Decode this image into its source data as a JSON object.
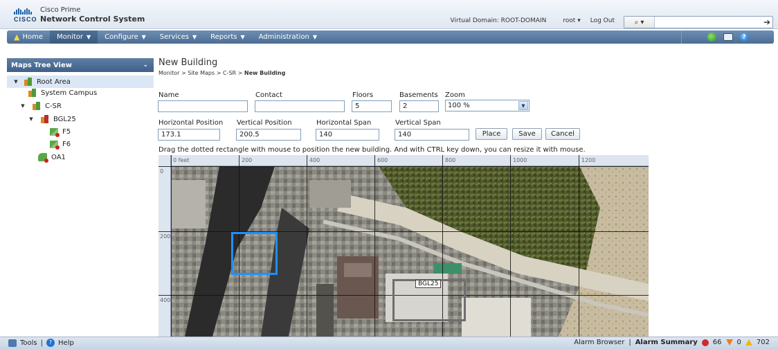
{
  "header": {
    "product_line1": "Cisco Prime",
    "product_line2": "Network Control System",
    "virtual_domain": "Virtual Domain: ROOT-DOMAIN",
    "user": "root ▾",
    "logout": "Log Out",
    "search_type": "⌕ ▾",
    "search_placeholder": "",
    "brand_color": "#1b5fa8"
  },
  "nav": {
    "home": "Home",
    "monitor": "Monitor",
    "configure": "Configure",
    "services": "Services",
    "reports": "Reports",
    "administration": "Administration"
  },
  "sidebar": {
    "title": "Maps Tree View",
    "items": [
      {
        "label": "Root Area",
        "expanded": true,
        "icon": "building-icon"
      },
      {
        "label": "System Campus",
        "icon": "building-icon"
      },
      {
        "label": "C-SR",
        "expanded": true,
        "icon": "building-icon"
      },
      {
        "label": "BGL25",
        "expanded": true,
        "icon": "building-alarm-icon"
      },
      {
        "label": "F5",
        "icon": "floor-icon"
      },
      {
        "label": "F6",
        "icon": "floor-icon"
      },
      {
        "label": "OA1",
        "icon": "outdoor-area-icon"
      }
    ]
  },
  "main": {
    "title": "New Building",
    "breadcrumb": [
      "Monitor",
      "Site Maps",
      "C-SR",
      "New Building"
    ],
    "fields": {
      "name_label": "Name",
      "name_value": "",
      "contact_label": "Contact",
      "contact_value": "",
      "floors_label": "Floors",
      "floors_value": "5",
      "basements_label": "Basements",
      "basements_value": "2",
      "zoom_label": "Zoom",
      "zoom_value": "100 %",
      "hpos_label": "Horizontal Position",
      "hpos_value": "173.1",
      "vpos_label": "Vertical Position",
      "vpos_value": "200.5",
      "hspan_label": "Horizontal Span",
      "hspan_value": "140",
      "vspan_label": "Vertical Span",
      "vspan_value": "140"
    },
    "buttons": {
      "place": "Place",
      "save": "Save",
      "cancel": "Cancel"
    },
    "instructions": "Drag the dotted rectangle with mouse to position the new building. And with CTRL key down, you can resize it with mouse."
  },
  "map": {
    "x_ticks": [
      "0 feet",
      "200",
      "400",
      "600",
      "800",
      "1000",
      "1200"
    ],
    "y_ticks": [
      "0",
      "200",
      "400"
    ],
    "existing_building_label": "BGL25",
    "selection_color": "#1e90ff"
  },
  "footer": {
    "tools": "Tools",
    "help": "Help",
    "alarm_browser": "Alarm Browser",
    "alarm_summary": "Alarm Summary",
    "critical": "66",
    "major": "0",
    "minor": "702"
  }
}
